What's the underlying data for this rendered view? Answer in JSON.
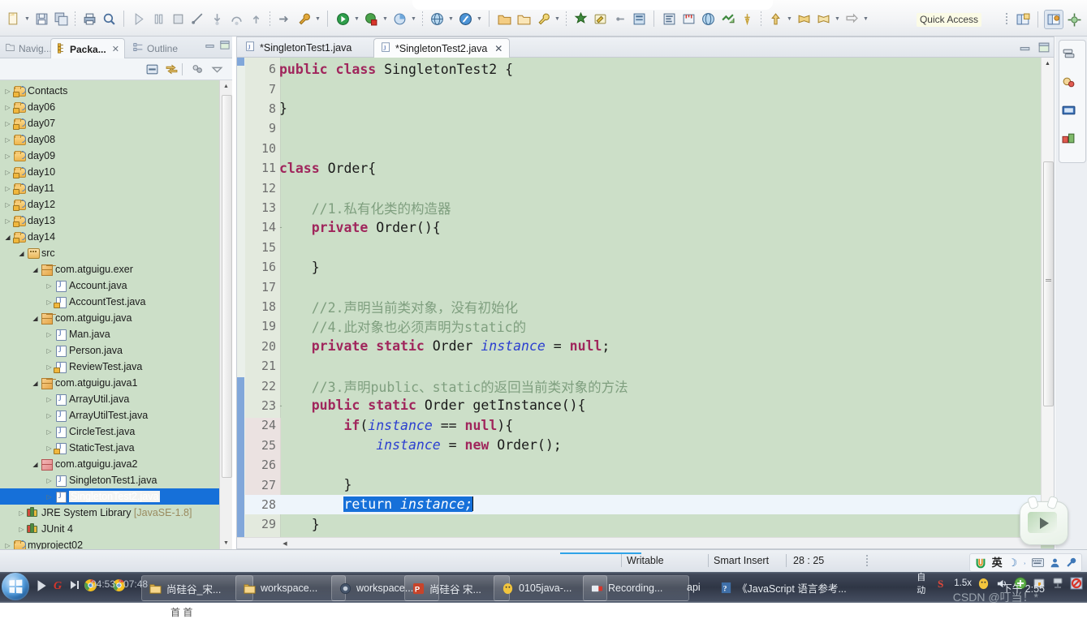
{
  "toolbar": {
    "quick_access": "Quick Access",
    "groups": [
      {
        "name": "new",
        "items": [
          {
            "icon": "new-file-icon",
            "caret": true
          },
          {
            "icon": "save-icon",
            "caret": false
          },
          {
            "icon": "save-all-icon",
            "caret": false
          }
        ]
      },
      {
        "name": "print",
        "items": [
          {
            "icon": "print-icon",
            "caret": false
          },
          {
            "icon": "inspect-icon",
            "caret": false
          }
        ]
      },
      {
        "name": "debugctl",
        "items": [
          {
            "icon": "resume-icon",
            "caret": false
          },
          {
            "icon": "suspend-icon",
            "caret": false
          },
          {
            "icon": "terminate-icon",
            "caret": false
          },
          {
            "icon": "disconnect-icon",
            "caret": false
          },
          {
            "icon": "step-into-icon",
            "caret": false
          },
          {
            "icon": "step-over-icon",
            "caret": false
          },
          {
            "icon": "step-return-icon",
            "caret": false
          }
        ]
      },
      {
        "name": "run",
        "items": [
          {
            "icon": "run-last-icon",
            "caret": false
          },
          {
            "icon": "external-tools-icon",
            "caret": true
          }
        ]
      },
      {
        "name": "launch",
        "items": [
          {
            "icon": "debug-icon",
            "caret": true
          },
          {
            "icon": "run-icon",
            "caret": true
          },
          {
            "icon": "coverage-icon",
            "caret": true
          }
        ]
      },
      {
        "name": "web",
        "items": [
          {
            "icon": "globe-icon",
            "caret": true
          },
          {
            "icon": "browser-icon",
            "caret": true
          }
        ]
      },
      {
        "name": "newwiz",
        "items": [
          {
            "icon": "new-project-icon",
            "caret": false
          },
          {
            "icon": "new-package-icon",
            "caret": false
          },
          {
            "icon": "new-class-icon",
            "caret": true
          }
        ]
      },
      {
        "name": "search",
        "items": [
          {
            "icon": "search-icon",
            "caret": false
          },
          {
            "icon": "highlight-icon",
            "caret": false
          },
          {
            "icon": "link-icon",
            "caret": false
          },
          {
            "icon": "book-icon",
            "caret": false
          }
        ]
      },
      {
        "name": "nav",
        "items": [
          {
            "icon": "outline-icon",
            "caret": false
          },
          {
            "icon": "ruler-icon",
            "caret": false
          },
          {
            "icon": "open-type-icon",
            "caret": false
          },
          {
            "icon": "open-task-icon",
            "caret": false
          },
          {
            "icon": "pin-icon",
            "caret": false
          }
        ]
      },
      {
        "name": "history",
        "items": [
          {
            "icon": "up-arrow-icon",
            "caret": true
          },
          {
            "icon": "back-arrow-icon",
            "caret": false
          },
          {
            "icon": "forward-arrow-icon",
            "caret": true
          },
          {
            "icon": "next-arrow-icon",
            "caret": true
          }
        ]
      }
    ],
    "right_icons": [
      "perspective-icon",
      "java-perspective-icon",
      "open-perspective-icon"
    ]
  },
  "left_panel": {
    "tabs": [
      {
        "label": "Navig...",
        "active": false,
        "icon": "navigator-icon",
        "closable": false
      },
      {
        "label": "Packa...",
        "active": true,
        "icon": "package-explorer-icon",
        "closable": true
      },
      {
        "label": "Outline",
        "active": false,
        "icon": "outline-icon",
        "closable": false
      }
    ],
    "view_buttons": [
      "minimize-icon",
      "maximize-icon"
    ],
    "panel_tools": [
      "collapse-all-icon",
      "link-with-editor-icon",
      "view-menu-icon",
      "view-dropdown-icon"
    ],
    "tree": [
      {
        "label": "Contacts",
        "depth": 0,
        "icon": "project-icon",
        "arrow": "closed",
        "locked": true
      },
      {
        "label": "day06",
        "depth": 0,
        "icon": "project-icon",
        "arrow": "closed",
        "locked": true
      },
      {
        "label": "day07",
        "depth": 0,
        "icon": "project-icon",
        "arrow": "closed",
        "locked": true
      },
      {
        "label": "day08",
        "depth": 0,
        "icon": "project-plain-icon",
        "arrow": "closed",
        "locked": false
      },
      {
        "label": "day09",
        "depth": 0,
        "icon": "project-plain-icon",
        "arrow": "closed",
        "locked": false
      },
      {
        "label": "day10",
        "depth": 0,
        "icon": "project-icon",
        "arrow": "closed",
        "locked": true
      },
      {
        "label": "day11",
        "depth": 0,
        "icon": "project-icon",
        "arrow": "closed",
        "locked": true
      },
      {
        "label": "day12",
        "depth": 0,
        "icon": "project-icon",
        "arrow": "closed",
        "locked": true
      },
      {
        "label": "day13",
        "depth": 0,
        "icon": "project-icon",
        "arrow": "closed",
        "locked": true
      },
      {
        "label": "day14",
        "depth": 0,
        "icon": "project-icon",
        "arrow": "open",
        "locked": true
      },
      {
        "label": "src",
        "depth": 1,
        "icon": "source-folder-icon",
        "arrow": "open",
        "locked": false
      },
      {
        "label": "com.atguigu.exer",
        "depth": 2,
        "icon": "package-icon",
        "arrow": "open",
        "locked": false
      },
      {
        "label": "Account.java",
        "depth": 3,
        "icon": "java-file-icon",
        "arrow": "closed",
        "locked": false
      },
      {
        "label": "AccountTest.java",
        "depth": 3,
        "icon": "java-file-lock-icon",
        "arrow": "closed",
        "locked": true
      },
      {
        "label": "com.atguigu.java",
        "depth": 2,
        "icon": "package-icon",
        "arrow": "open",
        "locked": false
      },
      {
        "label": "Man.java",
        "depth": 3,
        "icon": "java-file-icon",
        "arrow": "closed",
        "locked": false
      },
      {
        "label": "Person.java",
        "depth": 3,
        "icon": "java-file-icon",
        "arrow": "closed",
        "locked": false
      },
      {
        "label": "ReviewTest.java",
        "depth": 3,
        "icon": "java-file-lock-icon",
        "arrow": "closed",
        "locked": true
      },
      {
        "label": "com.atguigu.java1",
        "depth": 2,
        "icon": "package-icon",
        "arrow": "open",
        "locked": false
      },
      {
        "label": "ArrayUtil.java",
        "depth": 3,
        "icon": "java-file-icon",
        "arrow": "closed",
        "locked": false
      },
      {
        "label": "ArrayUtilTest.java",
        "depth": 3,
        "icon": "java-file-icon",
        "arrow": "closed",
        "locked": false
      },
      {
        "label": "CircleTest.java",
        "depth": 3,
        "icon": "java-file-icon",
        "arrow": "closed",
        "locked": false
      },
      {
        "label": "StaticTest.java",
        "depth": 3,
        "icon": "java-file-lock-icon",
        "arrow": "closed",
        "locked": true
      },
      {
        "label": "com.atguigu.java2",
        "depth": 2,
        "icon": "package-red-icon",
        "arrow": "open",
        "locked": false
      },
      {
        "label": "SingletonTest1.java",
        "depth": 3,
        "icon": "java-file-icon",
        "arrow": "closed",
        "locked": false
      },
      {
        "label": "SingletonTest2.java",
        "depth": 3,
        "icon": "java-file-icon",
        "arrow": "closed",
        "locked": false,
        "selected": true
      },
      {
        "label": "JRE System Library",
        "suffix": "[JavaSE-1.8]",
        "depth": 1,
        "icon": "library-icon",
        "arrow": "closed",
        "locked": false
      },
      {
        "label": "JUnit 4",
        "depth": 1,
        "icon": "library-icon",
        "arrow": "closed",
        "locked": false
      },
      {
        "label": "myproject02",
        "depth": 0,
        "icon": "project-plain-icon",
        "arrow": "closed",
        "locked": false
      }
    ]
  },
  "editor": {
    "tabs": [
      {
        "label": "*SingletonTest1.java",
        "active": false,
        "icon": "java-file-icon",
        "closable": false
      },
      {
        "label": "*SingletonTest2.java",
        "active": true,
        "icon": "java-file-icon",
        "closable": true
      }
    ],
    "window_buttons": [
      "minimize-icon",
      "maximize-icon"
    ],
    "first_line": 6,
    "lines": [
      {
        "n": 6,
        "fold": "",
        "segs": [
          {
            "t": "public ",
            "c": "kw"
          },
          {
            "t": "class ",
            "c": "kw"
          },
          {
            "t": "SingletonTest2 {",
            "c": "plain"
          }
        ]
      },
      {
        "n": 7,
        "fold": "",
        "segs": []
      },
      {
        "n": 8,
        "fold": "",
        "segs": [
          {
            "t": "}",
            "c": "plain"
          }
        ]
      },
      {
        "n": 9,
        "fold": "",
        "segs": []
      },
      {
        "n": 10,
        "fold": "",
        "segs": []
      },
      {
        "n": 11,
        "fold": "",
        "segs": [
          {
            "t": "class ",
            "c": "kw"
          },
          {
            "t": "Order{",
            "c": "plain"
          }
        ]
      },
      {
        "n": 12,
        "fold": "",
        "segs": []
      },
      {
        "n": 13,
        "fold": "",
        "segs": [
          {
            "t": "    //1.私有化类的构造器",
            "c": "cm"
          }
        ]
      },
      {
        "n": 14,
        "fold": "-",
        "segs": [
          {
            "t": "    private ",
            "c": "kw"
          },
          {
            "t": "Order(){",
            "c": "plain"
          }
        ]
      },
      {
        "n": 15,
        "fold": "",
        "segs": []
      },
      {
        "n": 16,
        "fold": "",
        "segs": [
          {
            "t": "    }",
            "c": "plain"
          }
        ]
      },
      {
        "n": 17,
        "fold": "",
        "segs": []
      },
      {
        "n": 18,
        "fold": "",
        "segs": [
          {
            "t": "    //2.声明当前类对象，没有初始化",
            "c": "cm"
          }
        ]
      },
      {
        "n": 19,
        "fold": "",
        "segs": [
          {
            "t": "    //4.此对象也必须声明为static的",
            "c": "cm"
          }
        ]
      },
      {
        "n": 20,
        "fold": "",
        "segs": [
          {
            "t": "    private static ",
            "c": "kw"
          },
          {
            "t": "Order ",
            "c": "plain"
          },
          {
            "t": "instance",
            "c": "fld"
          },
          {
            "t": " = ",
            "c": "plain"
          },
          {
            "t": "null",
            "c": "kw"
          },
          {
            "t": ";",
            "c": "plain"
          }
        ]
      },
      {
        "n": 21,
        "fold": "",
        "segs": []
      },
      {
        "n": 22,
        "fold": "",
        "segs": [
          {
            "t": "    //3.声明public、static的返回当前类对象的方法",
            "c": "cm"
          }
        ]
      },
      {
        "n": 23,
        "fold": "-",
        "segs": [
          {
            "t": "    public static ",
            "c": "kw"
          },
          {
            "t": "Order getInstance(){",
            "c": "plain"
          }
        ]
      },
      {
        "n": 24,
        "fold": "",
        "segs": [
          {
            "t": "        if",
            "c": "kw"
          },
          {
            "t": "(",
            "c": "plain"
          },
          {
            "t": "instance",
            "c": "fld"
          },
          {
            "t": " == ",
            "c": "plain"
          },
          {
            "t": "null",
            "c": "kw"
          },
          {
            "t": "){",
            "c": "plain"
          }
        ]
      },
      {
        "n": 25,
        "fold": "",
        "segs": [
          {
            "t": "            ",
            "c": "plain"
          },
          {
            "t": "instance",
            "c": "fld"
          },
          {
            "t": " = ",
            "c": "plain"
          },
          {
            "t": "new ",
            "c": "kw"
          },
          {
            "t": "Order();",
            "c": "plain"
          }
        ]
      },
      {
        "n": 26,
        "fold": "",
        "segs": []
      },
      {
        "n": 27,
        "fold": "",
        "segs": [
          {
            "t": "        }",
            "c": "plain"
          }
        ]
      },
      {
        "n": 28,
        "fold": "",
        "highlight": true,
        "segs": [
          {
            "t": "        ",
            "c": "plain"
          },
          {
            "t": "return ",
            "c": "sel"
          },
          {
            "t": "instance;",
            "c": "sel fld"
          }
        ]
      },
      {
        "n": 29,
        "fold": "",
        "segs": [
          {
            "t": "    }",
            "c": "plain"
          }
        ]
      }
    ]
  },
  "right_rail": {
    "icons": [
      "servers-icon",
      "debug-view-icon",
      "console-icon",
      "variables-icon"
    ]
  },
  "status_bar": {
    "writable": "Writable",
    "insert_mode": "Smart Insert",
    "position": "28 : 25",
    "ime_icons": [
      "ime-logo-icon",
      "chinese-mode-icon",
      "half-width-icon",
      "punctuation-icon",
      "keyboard-icon",
      "user-icon",
      "tools-icon"
    ],
    "ime_label": "英"
  },
  "taskbar": {
    "time_overlay": "04:53 / 07:48",
    "quick_launch": [
      "media-play-icon",
      "g-browser-icon",
      "chrome-old-icon",
      "chrome-icon"
    ],
    "items": [
      {
        "label": "尚硅谷_宋...",
        "icon": "folder-icon",
        "active": true
      },
      {
        "label": "workspace...",
        "icon": "folder-icon",
        "active": true
      },
      {
        "label": "workspace...",
        "icon": "eclipse-icon",
        "active": false
      },
      {
        "label": "尚硅谷 宋...",
        "icon": "powerpoint-icon",
        "active": false
      },
      {
        "label": "0105java-...",
        "icon": "qq-icon",
        "active": false
      },
      {
        "label": "Recording...",
        "icon": "recorder-icon",
        "active": false
      },
      {
        "label": "api",
        "icon": "",
        "active": false,
        "plain": true
      },
      {
        "label": "《JavaScript 语言参考...",
        "icon": "chm-icon",
        "active": false,
        "plain": true
      }
    ],
    "tray": [
      "auto-icon",
      "sogou-icon",
      "speed-1.5x-icon",
      "qq-tray-icon",
      "volume-icon",
      "plus-icon",
      "shield-icon",
      "net-icon",
      "stop-icon"
    ],
    "speed_label": "1.5x",
    "auto_label": "自动",
    "clock": "下午 2:55"
  },
  "watermark": "CSDN @叮当！*"
}
